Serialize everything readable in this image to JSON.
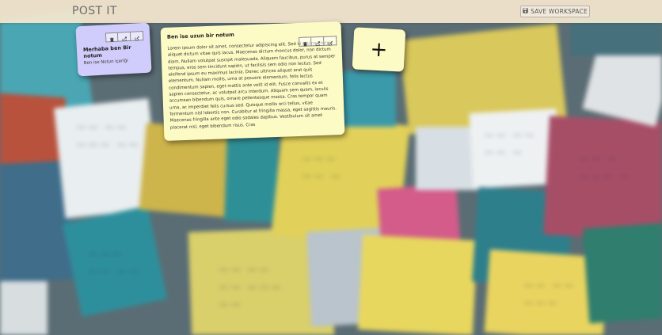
{
  "header": {
    "brand": "POST IT",
    "save_label": "SAVE WORKSPACE"
  },
  "notes": [
    {
      "title": "Merhaba ben Bir notum",
      "body": "Ben ise Notun içeriği",
      "color": "#d0ccfb"
    },
    {
      "title": "Ben ise uzun bir notum",
      "body": "Lorem ipsum dolor sit amet, consectetur adipiscing elit. Sed id nisl non turpis aliquet dictum vitae quis lacus. Maecenas dictum rhoncus dolor, non dictum diam. Nullam volutpat suscipit malesuada. Aliquam faucibus, purus at semper tempus, eros sem tincidunt sapien, ut facilisis sem odio non lectus. Sed eleifend ipsum eu maximus lacinia. Donec ultrices aliquet erat quis elementum. Nullam mollis, urna at posuere elementum, felis lectus condimentum sapien, eget mattis ante velit id elit. Fusce convallis ex et sapien consectetur, ac volutpat arcu interdum. Aliquam sem quam, iaculis accumsan bibendum quis, ornare pellentesque massa. Cras tempor quam urna, ac imperdiet felis cursus sed. Quisque mollis orci tellus, vitae fermentum nisl lobortis non. Curabitur at fringilla massa, eget sagittis mauris. Maecenas fringilla ante eget odio sodales dapibus. Vestibulum sit amet placerat nisl, eget bibendum risus. Cras",
      "color": "#fdfbc5"
    }
  ],
  "add_note": {
    "label": "+",
    "color": "#fdfbc5"
  },
  "icons": [
    "save-icon",
    "trash-icon",
    "share-icon",
    "edit-icon"
  ]
}
